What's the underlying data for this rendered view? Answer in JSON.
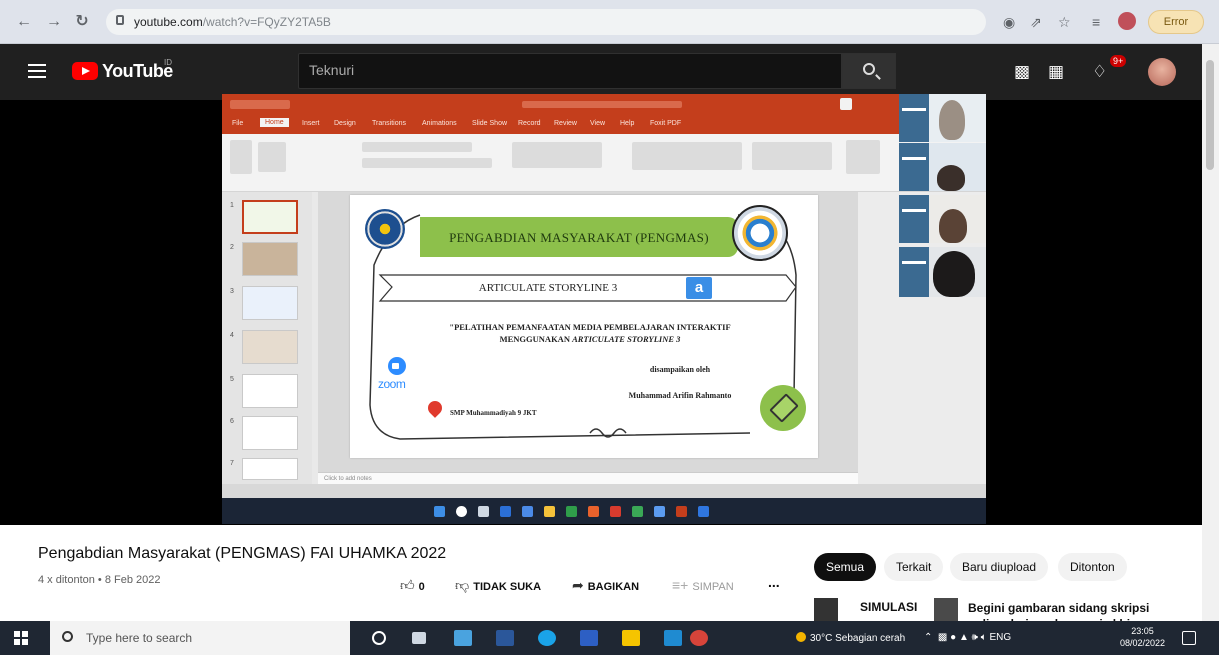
{
  "browser": {
    "url_host": "youtube.com",
    "url_path": "/watch?v=FQyZY2TA5B",
    "profile_label": "Error"
  },
  "youtube": {
    "logo_text": "YouTube",
    "logo_country": "ID",
    "search_value": "Teknuri",
    "notification_count": "9+"
  },
  "slide": {
    "title": "PENGABDIAN MASYARAKAT (PENGMAS)",
    "subtitle": "ARTICULATE STORYLINE 3",
    "heading_line1": "\"PELATIHAN PEMANFAATAN MEDIA PEMBELAJARAN INTERAKTIF",
    "heading_line2_prefix": "MENGGUNAKAN",
    "heading_line2_italic": "ARTICULATE STORYLINE 3",
    "presented_by": "disampaikan oleh",
    "presenter": "Muhammad Arifin Rahmanto",
    "school": "SMP Muhammadiyah 9 JKT",
    "zoom_text": "zoom",
    "storyline_letter": "a"
  },
  "ppt": {
    "menu": [
      "File",
      "Home",
      "Insert",
      "Design",
      "Transitions",
      "Animations",
      "Slide Show",
      "Record",
      "Review",
      "View",
      "Help",
      "Foxit PDF"
    ],
    "notes_placeholder": "Click to add notes",
    "thumb_numbers": [
      "1",
      "2",
      "3",
      "4",
      "5",
      "6",
      "7"
    ]
  },
  "video": {
    "title": "Pengabdian Masyarakat (PENGMAS) FAI UHAMKA 2022",
    "meta": "4 x ditonton • 8 Feb 2022",
    "like_count": "0",
    "dislike_label": "TIDAK SUKA",
    "share_label": "BAGIKAN",
    "save_label": "SIMPAN",
    "more_label": "..."
  },
  "chips": [
    "Semua",
    "Terkait",
    "Baru diupload",
    "Ditonton"
  ],
  "recommendations": [
    {
      "title": "SIMULASI"
    },
    {
      "title": "Begini gambaran sidang skripsi online dari awal sampai akhir"
    }
  ],
  "taskbar": {
    "search_placeholder": "Type here to search",
    "weather": "30°C  Sebagian cerah",
    "language": "ENG",
    "time": "23:05",
    "date": "08/02/2022"
  }
}
